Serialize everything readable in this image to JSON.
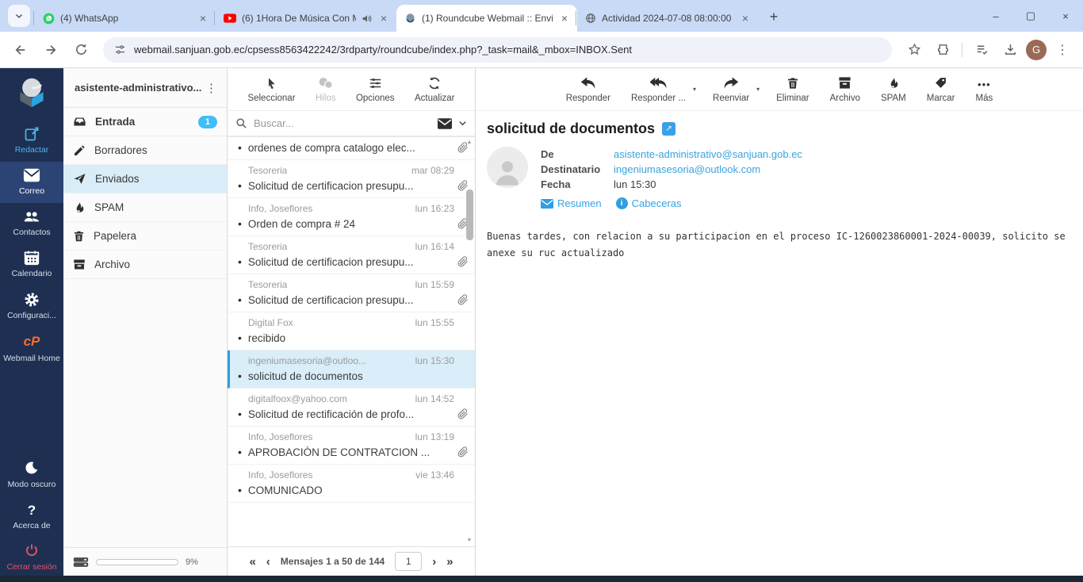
{
  "browser": {
    "tabs": [
      {
        "title": "(4) WhatsApp",
        "icon": "whatsapp-icon"
      },
      {
        "title": "(6) 1Hora De Música Con M",
        "icon": "youtube-icon",
        "audio": true
      },
      {
        "title": "(1) Roundcube Webmail :: Envi",
        "icon": "roundcube-icon",
        "active": true
      },
      {
        "title": "Actividad 2024-07-08 08:00:00",
        "icon": "globe-icon"
      }
    ],
    "close_glyph": "×",
    "new_tab_glyph": "+",
    "window_controls": {
      "minimize": "–",
      "maximize": "❐",
      "restore_glyph": "▢",
      "close": "×"
    },
    "url": "webmail.sanjuan.gob.ec/cpsess8563422242/3rdparty/roundcube/index.php?_task=mail&_mbox=INBOX.Sent",
    "avatar_letter": "G",
    "kebab_glyph": "⋮"
  },
  "app_nav": {
    "items": [
      {
        "label": "Redactar",
        "icon": "compose-icon"
      },
      {
        "label": "Correo",
        "icon": "envelope-icon",
        "selected": true
      },
      {
        "label": "Contactos",
        "icon": "contacts-icon"
      },
      {
        "label": "Calendario",
        "icon": "calendar-icon"
      },
      {
        "label": "Configuraci...",
        "icon": "gear-icon"
      },
      {
        "label": "Webmail Home",
        "icon": "cpanel-logo",
        "logo_text": "cP"
      },
      {
        "label": "Modo oscuro",
        "icon": "moon-icon"
      },
      {
        "label": "Acerca de",
        "icon": "question-icon",
        "glyph": "?"
      },
      {
        "label": "Cerrar sesión",
        "icon": "power-icon"
      }
    ]
  },
  "folder_pane": {
    "account": "asistente-administrativo...",
    "folders": [
      {
        "label": "Entrada",
        "icon": "inbox-icon",
        "badge": "1"
      },
      {
        "label": "Borradores",
        "icon": "pencil-icon"
      },
      {
        "label": "Enviados",
        "icon": "paperplane-icon",
        "selected": true
      },
      {
        "label": "SPAM",
        "icon": "flame-icon"
      },
      {
        "label": "Papelera",
        "icon": "trash-icon"
      },
      {
        "label": "Archivo",
        "icon": "archive-icon"
      }
    ],
    "quota_percent": "9%",
    "quota_fill_ratio": 0.09
  },
  "list_toolbar": {
    "select": "Seleccionar",
    "threads": "Hilos",
    "options": "Opciones",
    "refresh": "Actualizar"
  },
  "search": {
    "placeholder": "Buscar..."
  },
  "message_list": {
    "unread_dot": "•",
    "messages": [
      {
        "subject": "ordenes de compra catalogo elec...",
        "attachment": true
      },
      {
        "sender": "Tesoreria",
        "date": "mar 08:29",
        "subject": "Solicitud de certificacion presupu...",
        "attachment": true
      },
      {
        "sender": "Info, Joseflores",
        "date": "lun 16:23",
        "subject": "Orden de compra # 24",
        "attachment": true
      },
      {
        "sender": "Tesoreria",
        "date": "lun 16:14",
        "subject": "Solicitud de certificacion presupu...",
        "attachment": true
      },
      {
        "sender": "Tesoreria",
        "date": "lun 15:59",
        "subject": "Solicitud de certificacion presupu...",
        "attachment": true
      },
      {
        "sender": "Digital Fox",
        "date": "lun 15:55",
        "subject": "recibido",
        "attachment": false
      },
      {
        "sender": "ingeniumasesoria@outloo...",
        "date": "lun 15:30",
        "subject": "solicitud de documentos",
        "attachment": false,
        "selected": true
      },
      {
        "sender": "digitalfoox@yahoo.com",
        "date": "lun 14:52",
        "subject": "Solicitud de rectificación de profo...",
        "attachment": true
      },
      {
        "sender": "Info, Joseflores",
        "date": "lun 13:19",
        "subject": "APROBACIÓN DE CONTRATCION ...",
        "attachment": true
      },
      {
        "sender": "Info, Joseflores",
        "date": "vie 13:46",
        "subject": "COMUNICADO",
        "attachment": false
      }
    ],
    "pager": {
      "first": "«",
      "prev": "‹",
      "status": "Mensajes 1 a 50 de 144",
      "page": "1",
      "next": "›",
      "last": "»"
    },
    "scroll_up_glyph": "▲",
    "scroll_down_glyph": "▼"
  },
  "mail_toolbar": {
    "reply": "Responder",
    "reply_all": "Responder ...",
    "forward": "Reenviar",
    "delete": "Eliminar",
    "archive": "Archivo",
    "spam": "SPAM",
    "mark": "Marcar",
    "more": "Más",
    "more_glyph": "•••",
    "caret_glyph": "▾"
  },
  "message_view": {
    "subject": "solicitud de documentos",
    "from_label": "De",
    "from": "asistente-administrativo@sanjuan.gob.ec",
    "to_label": "Destinatario",
    "to": "ingeniumasesoria@outlook.com",
    "date_label": "Fecha",
    "date": "lun 15:30",
    "summary_label": "Resumen",
    "headers_label": "Cabeceras",
    "info_glyph": "i",
    "ext_glyph": "↗",
    "body": "Buenas tardes, con relacion a su participacion en el proceso IC-1260023860001-2024-00039, solicito se anexe su ruc actualizado"
  },
  "colors": {
    "tabstrip_bg": "#c9daf6",
    "sidenav_bg": "#1e2f52",
    "sidenav_selected": "#2c4474",
    "accent_blue": "#38a3df",
    "compose_blue": "#4db5ea",
    "badge_blue": "#41bdf7",
    "selected_row_bg": "#d9eef9",
    "cpanel_orange": "#ff6c2c",
    "logout_red": "#e8516b",
    "avatar_brown": "#9a6a56"
  }
}
